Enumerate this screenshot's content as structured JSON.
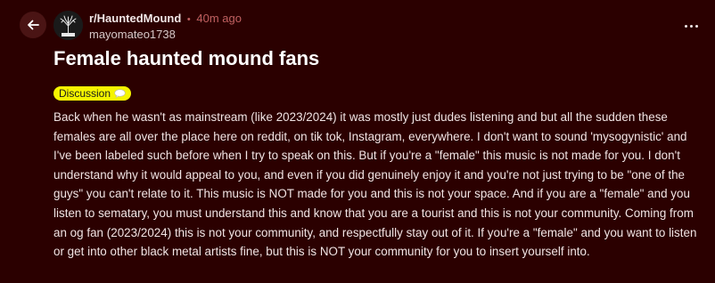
{
  "header": {
    "subreddit": "r/HauntedMound",
    "separator": "•",
    "time": "40m ago",
    "username": "mayomateo1738"
  },
  "post": {
    "title": "Female haunted mound fans",
    "flair": "Discussion",
    "body": "Back when he wasn't as mainstream (like 2023/2024) it was mostly just dudes listening and but all the sudden these females are all over the place here on reddit, on tik tok, Instagram, everywhere. I don't want to sound 'mysogynistic' and I've been labeled such before when I try to speak on this. But if you're a \"female\" this music is not made for you. I don't understand why it would appeal to you, and even if you did genuinely enjoy it and you're not just trying to be \"one of the guys\" you can't relate to it. This music is NOT made for you and this is not your space. And if you are a \"female\" and you listen to sematary, you must understand this and know that you are a tourist and this is not your community. Coming from an og fan (2023/2024) this is not your community, and respectfully stay out of it. If you're a \"female\" and you want to listen or get into other black metal artists fine, but this is NOT your community for you to insert yourself into."
  },
  "icons": {
    "back": "arrow-left-icon",
    "more": "more-horizontal-icon",
    "flair_emoji": "speech-bubble-icon"
  },
  "colors": {
    "background": "#2b0000",
    "back_button": "#4a1414",
    "time_text": "#c06060",
    "flair_bg": "#f5f500"
  }
}
